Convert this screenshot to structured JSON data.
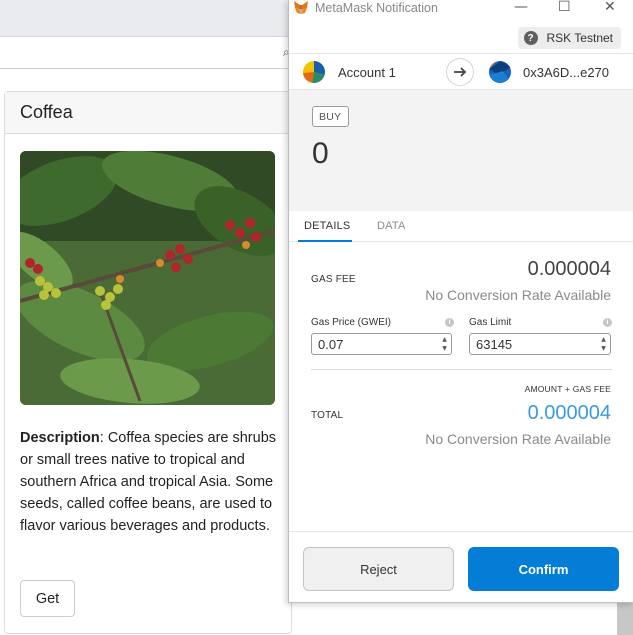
{
  "popup": {
    "window_title": "MetaMask Notification",
    "controls": {
      "minimize": "—",
      "maximize": "☐",
      "close": "✕"
    },
    "network": {
      "help_glyph": "?",
      "label": "RSK Testnet"
    },
    "from_account": "Account 1",
    "to_address": "0x3A6D...e270",
    "action_badge": "BUY",
    "amount": "0",
    "tabs": [
      {
        "label": "DETAILS",
        "active": true
      },
      {
        "label": "DATA",
        "active": false
      }
    ],
    "gas_fee": {
      "label": "GAS FEE",
      "value": "0.000004",
      "conversion": "No Conversion Rate Available"
    },
    "gas_price": {
      "label": "Gas Price (GWEI)",
      "value": "0.07"
    },
    "gas_limit": {
      "label": "Gas Limit",
      "value": "63145"
    },
    "total": {
      "heading": "AMOUNT + GAS FEE",
      "label": "TOTAL",
      "value": "0.000004",
      "conversion": "No Conversion Rate Available"
    },
    "buttons": {
      "reject": "Reject",
      "confirm": "Confirm"
    },
    "colors": {
      "accent": "#037dd6",
      "total_value": "#3b9ae6"
    }
  },
  "page": {
    "card": {
      "title": "Coffea",
      "description_label": "Description",
      "description_text": ": Coffea species are shrubs or small trees native to tropical and southern Africa and tropical Asia. Some seeds, called coffee beans, are used to flavor various beverages and products.",
      "button": "Get"
    }
  }
}
